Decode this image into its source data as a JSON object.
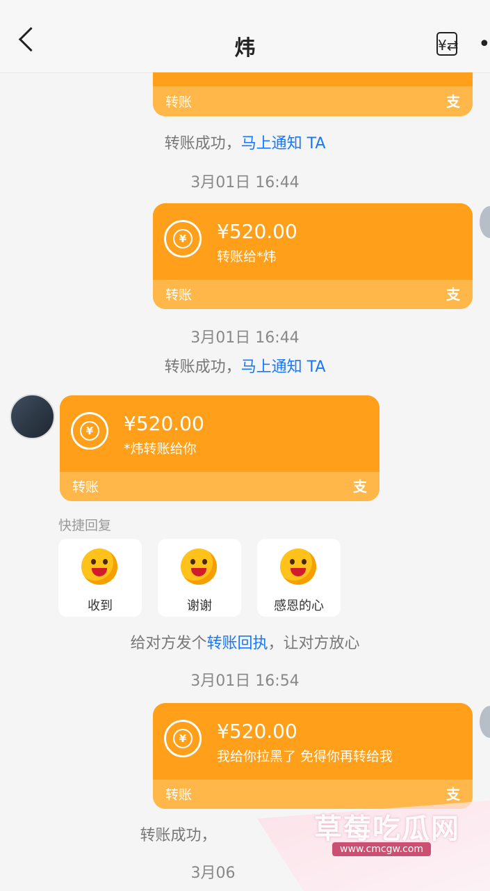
{
  "header": {
    "title": "炜",
    "transfer_icon": "¥⇄",
    "more_icon": "••"
  },
  "messages": {
    "card0": {
      "label": "转账",
      "brand": "支"
    },
    "note1": {
      "text": "转账成功，",
      "link": "马上通知 TA"
    },
    "time1": "3月01日 16:44",
    "card1": {
      "amount": "¥520.00",
      "desc": "转账给*炜",
      "label": "转账",
      "brand": "支"
    },
    "time2": "3月01日 16:44",
    "note2": {
      "text": "转账成功，",
      "link": "马上通知 TA"
    },
    "card2": {
      "amount": "¥520.00",
      "desc": "*炜转账给你",
      "label": "转账",
      "brand": "支"
    },
    "quick_reply": {
      "title": "快捷回复",
      "items": [
        "收到",
        "谢谢",
        "感恩的心"
      ]
    },
    "receipt_note": {
      "before": "给对方发个",
      "link": "转账回执",
      "after": "，让对方放心"
    },
    "time3": "3月01日 16:54",
    "card3": {
      "amount": "¥520.00",
      "desc": "我给你拉黑了 免得你再转给我",
      "label": "转账",
      "brand": "支"
    },
    "note3": {
      "text": "转账成功，"
    },
    "time4": "3月06"
  },
  "watermark": {
    "title": "草莓吃瓜网",
    "url": "www.cmcgw.com"
  }
}
